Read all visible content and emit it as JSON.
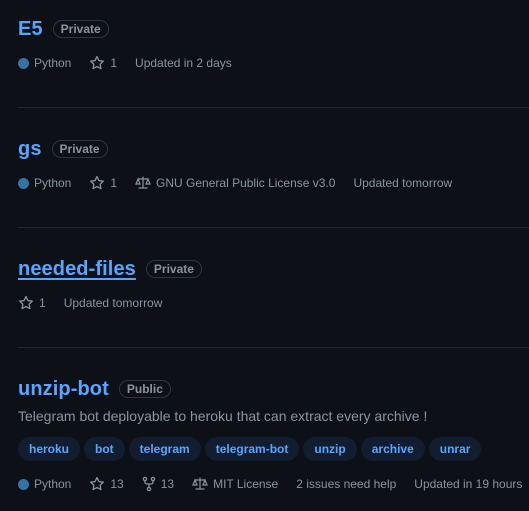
{
  "repos": [
    {
      "name": "E5",
      "visibility": "Private",
      "language": "Python",
      "stars": "1",
      "updated": "Updated in 2 days"
    },
    {
      "name": "gs",
      "visibility": "Private",
      "language": "Python",
      "stars": "1",
      "license": "GNU General Public License v3.0",
      "updated": "Updated tomorrow"
    },
    {
      "name": "needed-files",
      "visibility": "Private",
      "stars": "1",
      "updated": "Updated tomorrow"
    },
    {
      "name": "unzip-bot",
      "visibility": "Public",
      "description": "Telegram bot deployable to heroku that can extract every archive !",
      "topics": [
        "heroku",
        "bot",
        "telegram",
        "telegram-bot",
        "unzip",
        "archive",
        "unrar"
      ],
      "language": "Python",
      "stars": "13",
      "forks": "13",
      "license": "MIT License",
      "issues": "2 issues need help",
      "updated": "Updated in 19 hours"
    }
  ],
  "colors": {
    "background": "#0d1117",
    "link": "#58a6ff",
    "muted": "#8b949e",
    "python": "#3572a5",
    "topic_bg": "#121d2f"
  },
  "icons": [
    "star-icon",
    "repo-forked-icon",
    "law-icon"
  ]
}
